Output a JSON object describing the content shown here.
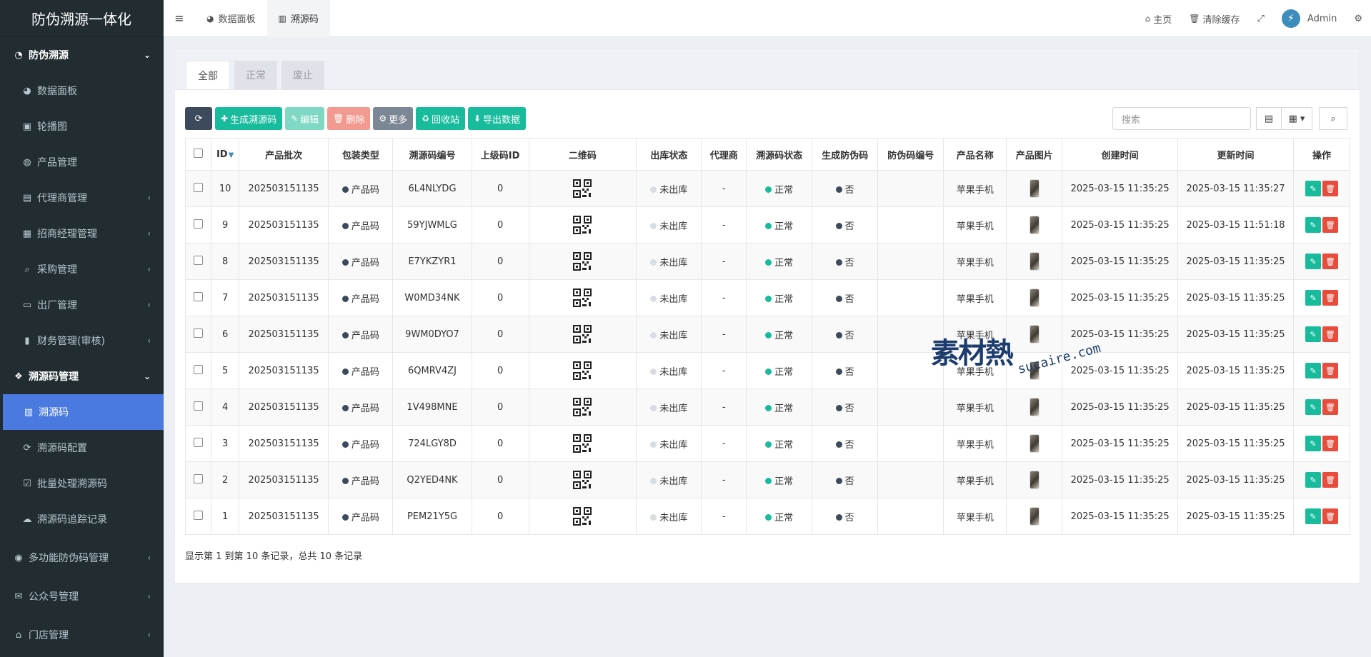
{
  "app": {
    "title": "防伪溯源一体化"
  },
  "sidebar": {
    "items": [
      {
        "label": "防伪溯源",
        "icon": "pie-icon",
        "type": "header-open",
        "caret": "⌄"
      },
      {
        "label": "数据面板",
        "icon": "dashboard-icon",
        "type": "sub"
      },
      {
        "label": "轮播图",
        "icon": "image-icon",
        "type": "sub"
      },
      {
        "label": "产品管理",
        "icon": "globe-icon",
        "type": "sub"
      },
      {
        "label": "代理商管理",
        "icon": "id-card-icon",
        "type": "sub-group",
        "caret": "‹"
      },
      {
        "label": "招商经理管理",
        "icon": "calendar-icon",
        "type": "sub-group",
        "caret": "‹"
      },
      {
        "label": "采购管理",
        "icon": "search-icon",
        "type": "sub-group",
        "caret": "‹"
      },
      {
        "label": "出厂管理",
        "icon": "hdd-icon",
        "type": "sub-group",
        "caret": "‹"
      },
      {
        "label": "财务管理(审核)",
        "icon": "book-icon",
        "type": "sub-group",
        "caret": "‹"
      },
      {
        "label": "溯源码管理",
        "icon": "cubes-icon",
        "type": "header-open",
        "caret": "⌄"
      },
      {
        "label": "溯源码",
        "icon": "barcode-icon",
        "type": "active"
      },
      {
        "label": "溯源码配置",
        "icon": "refresh-icon",
        "type": "sub"
      },
      {
        "label": "批量处理溯源码",
        "icon": "check-square-icon",
        "type": "sub"
      },
      {
        "label": "溯源码追踪记录",
        "icon": "cloud-icon",
        "type": "sub"
      },
      {
        "label": "多功能防伪码管理",
        "icon": "circle-icon",
        "type": "group",
        "caret": "‹"
      },
      {
        "label": "公众号管理",
        "icon": "wechat-icon",
        "type": "group",
        "caret": "‹"
      },
      {
        "label": "门店管理",
        "icon": "store-icon",
        "type": "group",
        "caret": "‹"
      }
    ]
  },
  "topbar": {
    "tabs": [
      {
        "label": "数据面板",
        "icon": "dashboard-icon"
      },
      {
        "label": "溯源码",
        "icon": "barcode-icon"
      }
    ],
    "home_label": "主页",
    "clear_cache_label": "清除缓存",
    "user_name": "Admin"
  },
  "panel": {
    "tabs": [
      "全部",
      "正常",
      "废止"
    ],
    "toolbar": {
      "refresh_icon": "refresh-icon",
      "generate_label": "生成溯源码",
      "edit_label": "编辑",
      "delete_label": "删除",
      "more_label": "更多",
      "recycle_label": "回收站",
      "export_label": "导出数据"
    },
    "search_placeholder": "搜索"
  },
  "table": {
    "headers": [
      "ID",
      "产品批次",
      "包装类型",
      "溯源码编号",
      "上级码ID",
      "二维码",
      "出库状态",
      "代理商",
      "溯源码状态",
      "生成防伪码",
      "防伪码编号",
      "产品名称",
      "产品图片",
      "创建时间",
      "更新时间",
      "操作"
    ],
    "rows": [
      {
        "id": "10",
        "batch": "202503151135",
        "pack": "产品码",
        "code": "6L4NLYDG",
        "parent": "0",
        "out": "未出库",
        "agent": "-",
        "status": "正常",
        "anti": "否",
        "anti_no": "",
        "product": "苹果手机",
        "created": "2025-03-15 11:35:25",
        "updated": "2025-03-15 11:35:27"
      },
      {
        "id": "9",
        "batch": "202503151135",
        "pack": "产品码",
        "code": "59YJWMLG",
        "parent": "0",
        "out": "未出库",
        "agent": "-",
        "status": "正常",
        "anti": "否",
        "anti_no": "",
        "product": "苹果手机",
        "created": "2025-03-15 11:35:25",
        "updated": "2025-03-15 11:51:18"
      },
      {
        "id": "8",
        "batch": "202503151135",
        "pack": "产品码",
        "code": "E7YKZYR1",
        "parent": "0",
        "out": "未出库",
        "agent": "-",
        "status": "正常",
        "anti": "否",
        "anti_no": "",
        "product": "苹果手机",
        "created": "2025-03-15 11:35:25",
        "updated": "2025-03-15 11:35:25"
      },
      {
        "id": "7",
        "batch": "202503151135",
        "pack": "产品码",
        "code": "W0MD34NK",
        "parent": "0",
        "out": "未出库",
        "agent": "-",
        "status": "正常",
        "anti": "否",
        "anti_no": "",
        "product": "苹果手机",
        "created": "2025-03-15 11:35:25",
        "updated": "2025-03-15 11:35:25"
      },
      {
        "id": "6",
        "batch": "202503151135",
        "pack": "产品码",
        "code": "9WM0DYO7",
        "parent": "0",
        "out": "未出库",
        "agent": "-",
        "status": "正常",
        "anti": "否",
        "anti_no": "",
        "product": "苹果手机",
        "created": "2025-03-15 11:35:25",
        "updated": "2025-03-15 11:35:25"
      },
      {
        "id": "5",
        "batch": "202503151135",
        "pack": "产品码",
        "code": "6QMRV4ZJ",
        "parent": "0",
        "out": "未出库",
        "agent": "-",
        "status": "正常",
        "anti": "否",
        "anti_no": "",
        "product": "苹果手机",
        "created": "2025-03-15 11:35:25",
        "updated": "2025-03-15 11:35:25"
      },
      {
        "id": "4",
        "batch": "202503151135",
        "pack": "产品码",
        "code": "1V498MNE",
        "parent": "0",
        "out": "未出库",
        "agent": "-",
        "status": "正常",
        "anti": "否",
        "anti_no": "",
        "product": "苹果手机",
        "created": "2025-03-15 11:35:25",
        "updated": "2025-03-15 11:35:25"
      },
      {
        "id": "3",
        "batch": "202503151135",
        "pack": "产品码",
        "code": "724LGY8D",
        "parent": "0",
        "out": "未出库",
        "agent": "-",
        "status": "正常",
        "anti": "否",
        "anti_no": "",
        "product": "苹果手机",
        "created": "2025-03-15 11:35:25",
        "updated": "2025-03-15 11:35:25"
      },
      {
        "id": "2",
        "batch": "202503151135",
        "pack": "产品码",
        "code": "Q2YED4NK",
        "parent": "0",
        "out": "未出库",
        "agent": "-",
        "status": "正常",
        "anti": "否",
        "anti_no": "",
        "product": "苹果手机",
        "created": "2025-03-15 11:35:25",
        "updated": "2025-03-15 11:35:25"
      },
      {
        "id": "1",
        "batch": "202503151135",
        "pack": "产品码",
        "code": "PEM21Y5G",
        "parent": "0",
        "out": "未出库",
        "agent": "-",
        "status": "正常",
        "anti": "否",
        "anti_no": "",
        "product": "苹果手机",
        "created": "2025-03-15 11:35:25",
        "updated": "2025-03-15 11:35:25"
      }
    ],
    "footer": "显示第 1 到第 10 条记录，总共 10 条记录"
  },
  "watermark": {
    "logo": "素材熱",
    "url": "sucaire.com"
  },
  "colors": {
    "sidebar_bg": "#222d32",
    "active_menu": "#4a7ae0",
    "success": "#18bc9c",
    "danger": "#e74c3c",
    "primary_dark": "#3c4a5c"
  }
}
